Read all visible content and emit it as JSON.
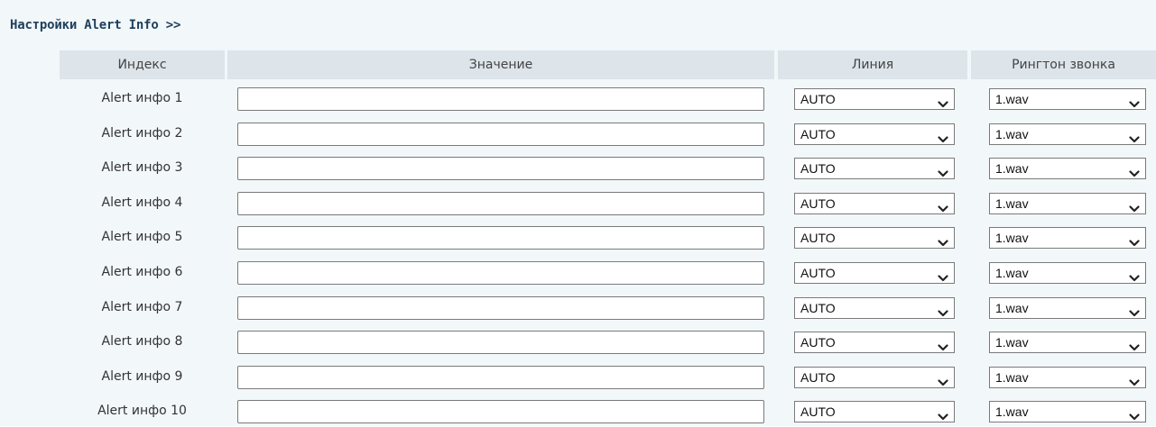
{
  "section": {
    "title": "Настройки Alert Info >>"
  },
  "table": {
    "headers": {
      "index": "Индекс",
      "value": "Значение",
      "line": "Линия",
      "ringtone": "Рингтон звонка"
    },
    "rows": [
      {
        "label": "Alert инфо 1",
        "value": "",
        "line": "AUTO",
        "ringtone": "1.wav"
      },
      {
        "label": "Alert инфо 2",
        "value": "",
        "line": "AUTO",
        "ringtone": "1.wav"
      },
      {
        "label": "Alert инфо 3",
        "value": "",
        "line": "AUTO",
        "ringtone": "1.wav"
      },
      {
        "label": "Alert инфо 4",
        "value": "",
        "line": "AUTO",
        "ringtone": "1.wav"
      },
      {
        "label": "Alert инфо 5",
        "value": "",
        "line": "AUTO",
        "ringtone": "1.wav"
      },
      {
        "label": "Alert инфо 6",
        "value": "",
        "line": "AUTO",
        "ringtone": "1.wav"
      },
      {
        "label": "Alert инфо 7",
        "value": "",
        "line": "AUTO",
        "ringtone": "1.wav"
      },
      {
        "label": "Alert инфо 8",
        "value": "",
        "line": "AUTO",
        "ringtone": "1.wav"
      },
      {
        "label": "Alert инфо 9",
        "value": "",
        "line": "AUTO",
        "ringtone": "1.wav"
      },
      {
        "label": "Alert инфо 10",
        "value": "",
        "line": "AUTO",
        "ringtone": "1.wav"
      }
    ]
  }
}
